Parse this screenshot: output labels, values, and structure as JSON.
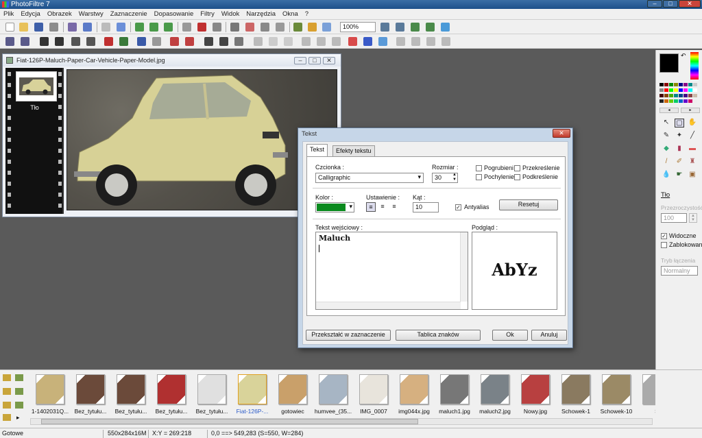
{
  "window": {
    "title": "PhotoFiltre 7"
  },
  "menu": [
    "Plik",
    "Edycja",
    "Obrazek",
    "Warstwy",
    "Zaznaczenie",
    "Dopasowanie",
    "Filtry",
    "Widok",
    "Narzędzia",
    "Okna",
    "?"
  ],
  "toolbar": {
    "zoom": "100%"
  },
  "image_window": {
    "title": "Fiat-126P-Maluch-Paper-Car-Vehicle-Paper-Model.jpg",
    "layer_label": "Tło"
  },
  "dialog": {
    "title": "Tekst",
    "tabs": [
      "Tekst",
      "Efekty tekstu"
    ],
    "font_label": "Czcionka :",
    "font_value": "Calligraphic",
    "size_label": "Rozmiar :",
    "size_value": "30",
    "bold": "Pogrubieni",
    "strike": "Przekreślenie",
    "italic": "Pochylenie",
    "underline": "Podkreślenie",
    "color_label": "Kolor :",
    "color_value": "#0a8a1e",
    "align_label": "Ustawienie :",
    "angle_label": "Kąt :",
    "angle_value": "10",
    "antialias": "Antyalias",
    "reset": "Resetuj",
    "input_label": "Tekst wejściowy :",
    "input_text": "Maluch",
    "preview_label": "Podgląd :",
    "preview_text": "AbYz",
    "btn_convert": "Przekształć w zaznaczenie",
    "btn_charmap": "Tablica znaków",
    "btn_ok": "Ok",
    "btn_cancel": "Anuluj"
  },
  "right_panel": {
    "layer_name": "Tło",
    "opacity_label": "Przezroczystość",
    "opacity_value": "100",
    "visible": "Widoczne",
    "locked": "Zablokowane",
    "blend_label": "Tryb łączenia",
    "blend_value": "Normalny"
  },
  "thumbnails": [
    {
      "name": "1-1402031Q...",
      "color": "#c8b27a"
    },
    {
      "name": "Bez_tytułu...",
      "color": "#6b4a3a"
    },
    {
      "name": "Bez_tytułu...",
      "color": "#6b4a3a"
    },
    {
      "name": "Bez_tytułu...",
      "color": "#b03030"
    },
    {
      "name": "Bez_tytułu...",
      "color": "#e0e0e0"
    },
    {
      "name": "Fiat-126P-...",
      "color": "#d9d39a",
      "active": true
    },
    {
      "name": "gotowiec",
      "color": "#c9a06a"
    },
    {
      "name": "humvee_(35...",
      "color": "#a7b5c4"
    },
    {
      "name": "IMG_0007",
      "color": "#e8e4dc"
    },
    {
      "name": "img044x.jpg",
      "color": "#d6b080"
    },
    {
      "name": "maluch1.jpg",
      "color": "#777777"
    },
    {
      "name": "maluch2.jpg",
      "color": "#7a8288"
    },
    {
      "name": "Nowy.jpg",
      "color": "#b84040"
    },
    {
      "name": "Schowek-1",
      "color": "#8a7a60"
    },
    {
      "name": "Schowek-10",
      "color": "#9b8a66"
    },
    {
      "name": "S",
      "color": "#aaaaaa"
    }
  ],
  "status": {
    "ready": "Gotowe",
    "size": "550x284x16M",
    "xy": "X:Y = 269:218",
    "sel": "0,0 ==> 549,283 (S=550, W=284)"
  }
}
